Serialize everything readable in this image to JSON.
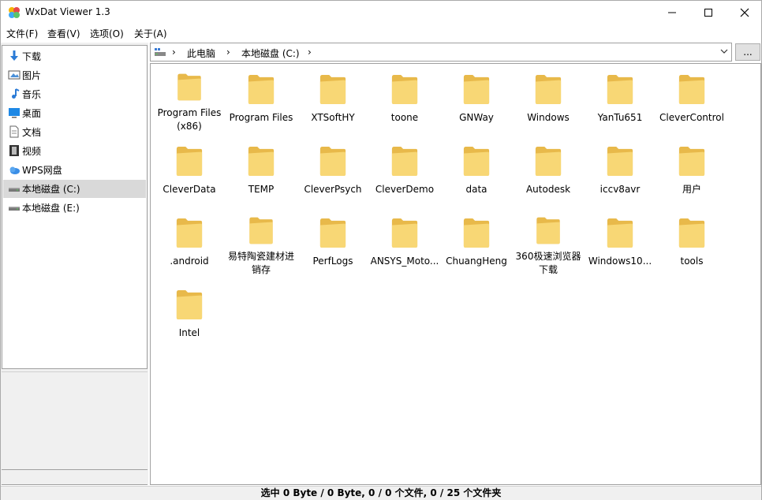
{
  "window": {
    "title": "WxDat Viewer 1.3"
  },
  "menu": [
    "文件(F)",
    "查看(V)",
    "选项(O)",
    "关于(A)"
  ],
  "tree": [
    {
      "label": "下载",
      "icon": "download-arrow-icon",
      "selected": false
    },
    {
      "label": "图片",
      "icon": "pictures-icon",
      "selected": false
    },
    {
      "label": "音乐",
      "icon": "music-note-icon",
      "selected": false
    },
    {
      "label": "桌面",
      "icon": "desktop-icon",
      "selected": false
    },
    {
      "label": "文档",
      "icon": "document-icon",
      "selected": false
    },
    {
      "label": "视频",
      "icon": "video-icon",
      "selected": false
    },
    {
      "label": "WPS网盘",
      "icon": "cloud-icon",
      "selected": false
    },
    {
      "label": "本地磁盘 (C:)",
      "icon": "drive-icon",
      "selected": true
    },
    {
      "label": "本地磁盘 (E:)",
      "icon": "drive-icon",
      "selected": false
    }
  ],
  "address": {
    "parts": [
      "此电脑",
      "本地磁盘 (C:)"
    ],
    "more_button": "..."
  },
  "files": [
    "Program Files (x86)",
    "Program Files",
    "XTSoftHY",
    "toone",
    "GNWay",
    "Windows",
    "YanTu651",
    "CleverControl",
    "CleverData",
    "TEMP",
    "CleverPsych",
    "CleverDemo",
    "data",
    "Autodesk",
    "iccv8avr",
    "用户",
    ".android",
    "易特陶瓷建材进销存",
    "PerfLogs",
    "ANSYS_Moto...",
    "ChuangHeng",
    "360极速浏览器下载",
    "Windows10...",
    "tools",
    "Intel"
  ],
  "status": "选中 0 Byte / 0 Byte, 0 / 0 个文件, 0 / 25 个文件夹",
  "colors": {
    "folder": "#f8d775",
    "folder_dark": "#e8b94a",
    "selection": "#d9d9d9"
  }
}
